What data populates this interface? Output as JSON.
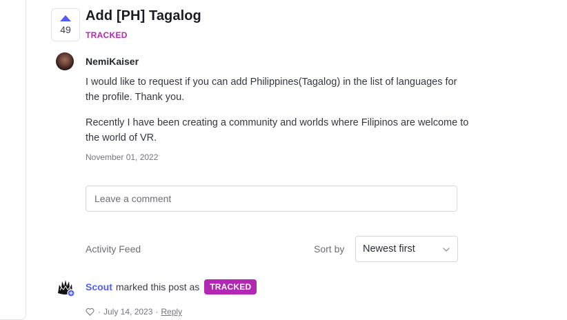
{
  "post": {
    "vote_count": "49",
    "title": "Add [PH] Tagalog",
    "status": "TRACKED",
    "author": "NemiKaiser",
    "body": [
      "I would like to request if you can add Philippines(Tagalog) in the list of languages for the profile. Thank you.",
      "Recently I have been creating a community and worlds where Filipinos are welcome to the world of VR."
    ],
    "date": "November 01, 2022"
  },
  "comment": {
    "placeholder": "Leave a comment"
  },
  "activity": {
    "feed_label": "Activity Feed",
    "sort_label": "Sort by",
    "sort_value": "Newest first",
    "entry": {
      "actor": "Scout",
      "action": "marked this post as",
      "status": "TRACKED",
      "date": "July 14, 2023",
      "reply": "Reply",
      "separator": "·"
    }
  },
  "colors": {
    "accent": "#525df9",
    "tracked": "#b227b3"
  },
  "icons": [
    "upvote-arrow-icon",
    "heart-icon",
    "chevron-down-icon",
    "scout-avatar-icon"
  ]
}
